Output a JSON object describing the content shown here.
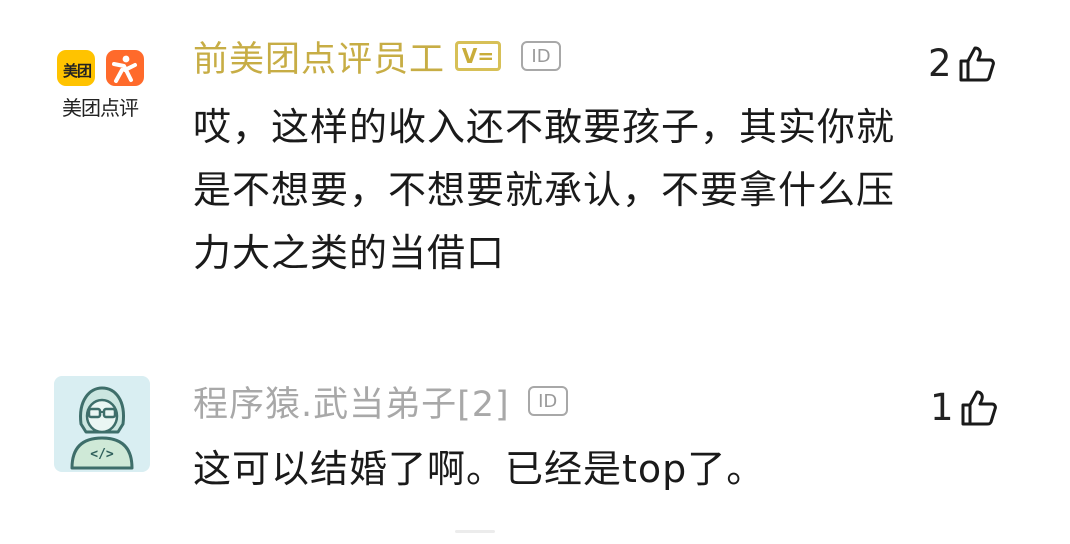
{
  "comments": [
    {
      "username": "前美团点评员工",
      "username_color": "#c7ad45",
      "badge_v": "V=",
      "badge_id": "ID",
      "avatar_logo_text": "美团",
      "avatar_caption": "美团点评",
      "likes": "2",
      "text_lines": [
        "哎，这样的收入还不敢要孩子，其实你就",
        "是不想要，不想要就承认，不要拿什么压",
        "力大之类的当借口"
      ]
    },
    {
      "username": "程序猿.武当弟子[2]",
      "username_color": "#a8a8a8",
      "badge_id": "ID",
      "avatar_code_text": "</>",
      "likes": "1",
      "text_lines": [
        "这可以结婚了啊。已经是top了。"
      ]
    }
  ],
  "colors": {
    "meituan_yellow": "#ffc300",
    "meituan_orange": "#ff6a2b",
    "dev_avatar_bg": "#d9eef2",
    "dev_avatar_stroke": "#3e6e6a"
  },
  "icons": {
    "like": "thumbs-up-icon",
    "meituan": "meituan-logo-icon",
    "programmer": "programmer-avatar-icon"
  }
}
